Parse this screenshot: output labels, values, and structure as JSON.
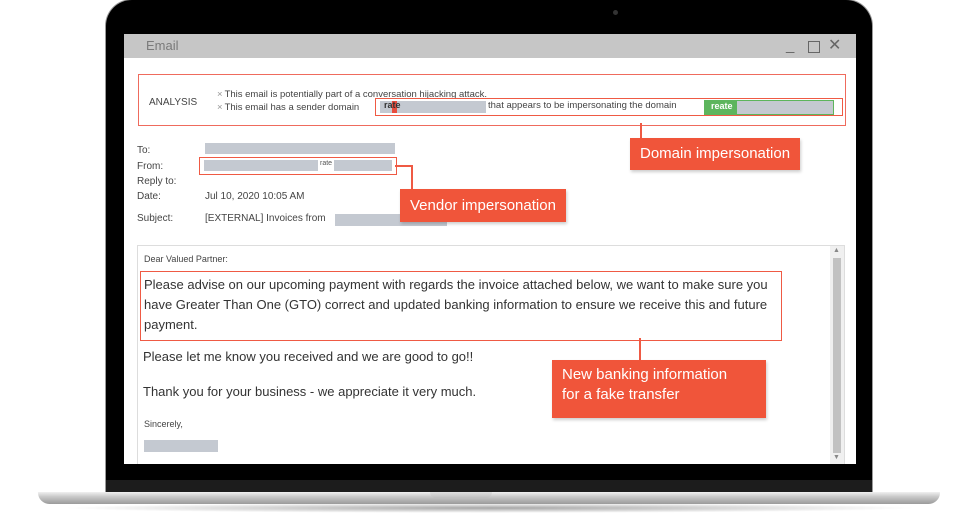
{
  "window": {
    "title": "Email",
    "minimize_label": "_",
    "close_label": "✕"
  },
  "analysis": {
    "label": "ANALYSIS",
    "lines": [
      "This email is potentially part of a conversation hijacking attack.",
      "This email has a sender domain"
    ],
    "mark": "×",
    "sender_domain_fragment": "rate",
    "middle_text": "that appears to be impersonating the domain",
    "impersonated_domain_fragment": "reate"
  },
  "headers": {
    "to_label": "To:",
    "from_label": "From:",
    "reply_to_label": "Reply to:",
    "date_label": "Date:",
    "date_value": "Jul 10, 2020 10:05 AM",
    "subject_label": "Subject:",
    "subject_value": "[EXTERNAL] Invoices from",
    "from_fragment": "rate"
  },
  "body": {
    "salutation": "Dear Valued Partner:",
    "paragraph1": "Please advise on our upcoming payment with regards the invoice attached below, we want to make sure you have Greater Than One (GTO) correct and updated banking information to ensure we receive this and future payment.",
    "paragraph2": "Please let me know you received and we are good to go!!",
    "paragraph3": "Thank you for your business - we appreciate it very much.",
    "closing": "Sincerely,"
  },
  "callouts": {
    "domain": "Domain impersonation",
    "vendor": "Vendor impersonation",
    "banking_line1": "New banking information",
    "banking_line2": "for a fake transfer"
  },
  "colors": {
    "callout": "#f0553a",
    "highlight_border": "#ef5a44",
    "green": "#5db55d",
    "redaction": "#c4c9d1"
  }
}
